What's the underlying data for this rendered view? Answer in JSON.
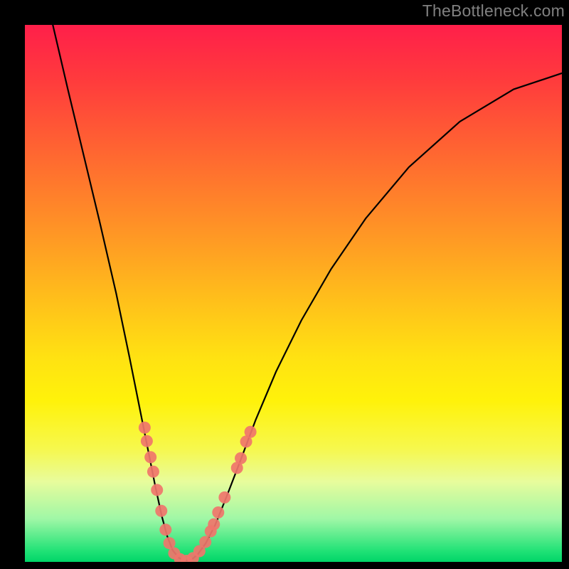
{
  "watermark": "TheBottleneck.com",
  "chart_data": {
    "type": "line",
    "title": "",
    "xlabel": "",
    "ylabel": "",
    "series": [
      {
        "name": "curve",
        "points": [
          {
            "x": 0.052,
            "y": 1.0
          },
          {
            "x": 0.08,
            "y": 0.88
          },
          {
            "x": 0.11,
            "y": 0.755
          },
          {
            "x": 0.14,
            "y": 0.63
          },
          {
            "x": 0.17,
            "y": 0.5
          },
          {
            "x": 0.195,
            "y": 0.38
          },
          {
            "x": 0.215,
            "y": 0.28
          },
          {
            "x": 0.231,
            "y": 0.2
          },
          {
            "x": 0.243,
            "y": 0.14
          },
          {
            "x": 0.255,
            "y": 0.085
          },
          {
            "x": 0.265,
            "y": 0.048
          },
          {
            "x": 0.275,
            "y": 0.022
          },
          {
            "x": 0.286,
            "y": 0.008
          },
          {
            "x": 0.298,
            "y": 0.002
          },
          {
            "x": 0.31,
            "y": 0.004
          },
          {
            "x": 0.322,
            "y": 0.014
          },
          {
            "x": 0.337,
            "y": 0.035
          },
          {
            "x": 0.354,
            "y": 0.068
          },
          {
            "x": 0.375,
            "y": 0.12
          },
          {
            "x": 0.4,
            "y": 0.185
          },
          {
            "x": 0.43,
            "y": 0.265
          },
          {
            "x": 0.468,
            "y": 0.355
          },
          {
            "x": 0.515,
            "y": 0.45
          },
          {
            "x": 0.57,
            "y": 0.545
          },
          {
            "x": 0.635,
            "y": 0.64
          },
          {
            "x": 0.715,
            "y": 0.735
          },
          {
            "x": 0.81,
            "y": 0.82
          },
          {
            "x": 0.91,
            "y": 0.88
          },
          {
            "x": 1.0,
            "y": 0.91
          }
        ]
      },
      {
        "name": "markers",
        "points": [
          {
            "x": 0.223,
            "y": 0.25
          },
          {
            "x": 0.227,
            "y": 0.225
          },
          {
            "x": 0.234,
            "y": 0.195
          },
          {
            "x": 0.239,
            "y": 0.168
          },
          {
            "x": 0.246,
            "y": 0.134
          },
          {
            "x": 0.254,
            "y": 0.095
          },
          {
            "x": 0.262,
            "y": 0.06
          },
          {
            "x": 0.269,
            "y": 0.035
          },
          {
            "x": 0.278,
            "y": 0.016
          },
          {
            "x": 0.289,
            "y": 0.005
          },
          {
            "x": 0.301,
            "y": 0.002
          },
          {
            "x": 0.313,
            "y": 0.007
          },
          {
            "x": 0.325,
            "y": 0.02
          },
          {
            "x": 0.336,
            "y": 0.037
          },
          {
            "x": 0.346,
            "y": 0.057
          },
          {
            "x": 0.352,
            "y": 0.07
          },
          {
            "x": 0.36,
            "y": 0.092
          },
          {
            "x": 0.372,
            "y": 0.12
          },
          {
            "x": 0.395,
            "y": 0.175
          },
          {
            "x": 0.402,
            "y": 0.193
          },
          {
            "x": 0.412,
            "y": 0.224
          },
          {
            "x": 0.42,
            "y": 0.242
          }
        ]
      }
    ],
    "xlim": [
      0,
      1
    ],
    "ylim": [
      0,
      1
    ],
    "colors": {
      "curve": "#000000",
      "markers": "#f0756b",
      "background_top": "#ff1f4a",
      "background_bottom": "#00d568"
    }
  }
}
